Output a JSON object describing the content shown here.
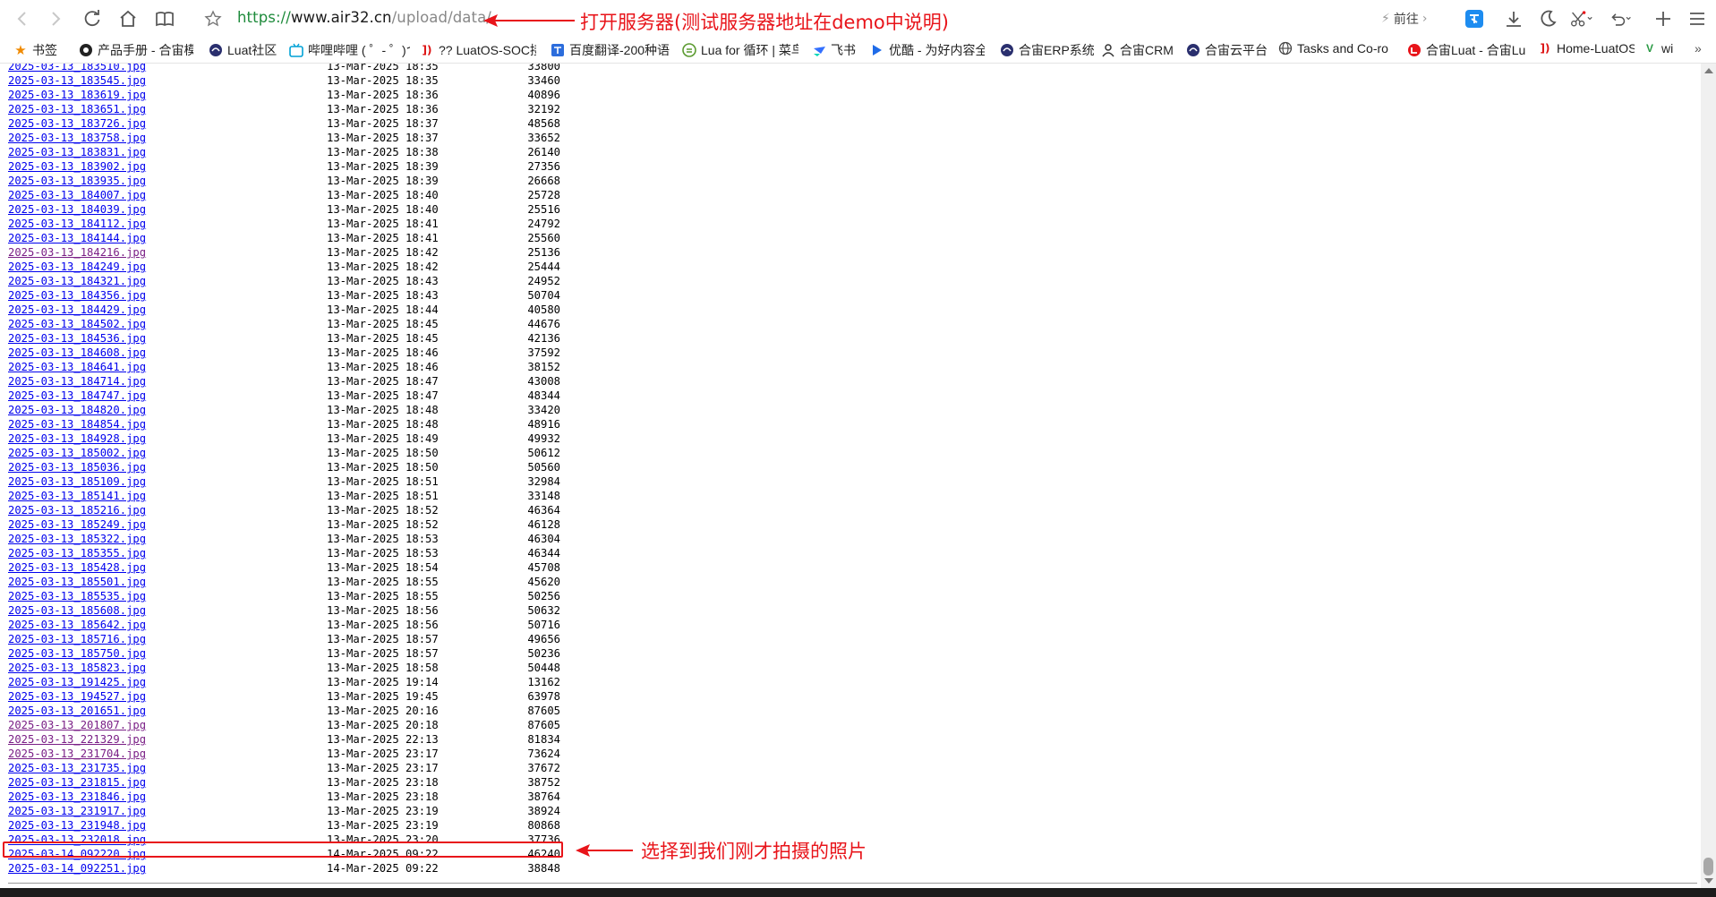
{
  "browser": {
    "url_scheme": "https://",
    "url_host": "www.air32.cn",
    "url_path": "/upload/data/",
    "goto_label": "前往"
  },
  "bookmarks": [
    {
      "label": "书签",
      "icon": "star-icon"
    },
    {
      "label": "产品手册 - 合宙模",
      "icon": "site-icon"
    },
    {
      "label": "Luat社区",
      "icon": "site-icon"
    },
    {
      "label": "哔哩哔哩 ( ゜- ゜)つ",
      "icon": "bilibili-icon"
    },
    {
      "label": "?? LuatOS-SOC接",
      "icon": "luatos-icon"
    },
    {
      "label": "百度翻译-200种语",
      "icon": "translate-icon"
    },
    {
      "label": "Lua for 循环 | 菜鸟",
      "icon": "runoob-icon"
    },
    {
      "label": "飞书",
      "icon": "feishu-icon"
    },
    {
      "label": "优酷 - 为好内容全",
      "icon": "youku-icon"
    },
    {
      "label": "合宙ERP系统",
      "icon": "site-icon"
    },
    {
      "label": "合宙CRM",
      "icon": "person-icon"
    },
    {
      "label": "合宙云平台",
      "icon": "site-icon"
    },
    {
      "label": "Tasks and Co-ro",
      "icon": "globe-icon"
    },
    {
      "label": "合宙Luat - 合宙Lu",
      "icon": "luat-icon"
    },
    {
      "label": "Home-LuatOS",
      "icon": "luatos-icon"
    },
    {
      "label": "wi",
      "icon": "v-icon"
    }
  ],
  "listing": {
    "partial_top_row": {
      "name": "2025-03-13_183510.jpg",
      "date": "13-Mar-2025 18:35",
      "size": "33800"
    },
    "rows": [
      {
        "name": "2025-03-13_183545.jpg",
        "date": "13-Mar-2025 18:35",
        "size": "33460"
      },
      {
        "name": "2025-03-13_183619.jpg",
        "date": "13-Mar-2025 18:36",
        "size": "40896"
      },
      {
        "name": "2025-03-13_183651.jpg",
        "date": "13-Mar-2025 18:36",
        "size": "32192"
      },
      {
        "name": "2025-03-13_183726.jpg",
        "date": "13-Mar-2025 18:37",
        "size": "48568"
      },
      {
        "name": "2025-03-13_183758.jpg",
        "date": "13-Mar-2025 18:37",
        "size": "33652"
      },
      {
        "name": "2025-03-13_183831.jpg",
        "date": "13-Mar-2025 18:38",
        "size": "26140"
      },
      {
        "name": "2025-03-13_183902.jpg",
        "date": "13-Mar-2025 18:39",
        "size": "27356"
      },
      {
        "name": "2025-03-13_183935.jpg",
        "date": "13-Mar-2025 18:39",
        "size": "26668"
      },
      {
        "name": "2025-03-13_184007.jpg",
        "date": "13-Mar-2025 18:40",
        "size": "25728"
      },
      {
        "name": "2025-03-13_184039.jpg",
        "date": "13-Mar-2025 18:40",
        "size": "25516"
      },
      {
        "name": "2025-03-13_184112.jpg",
        "date": "13-Mar-2025 18:41",
        "size": "24792"
      },
      {
        "name": "2025-03-13_184144.jpg",
        "date": "13-Mar-2025 18:41",
        "size": "25560"
      },
      {
        "name": "2025-03-13_184216.jpg",
        "date": "13-Mar-2025 18:42",
        "size": "25136",
        "visited": true
      },
      {
        "name": "2025-03-13_184249.jpg",
        "date": "13-Mar-2025 18:42",
        "size": "25444"
      },
      {
        "name": "2025-03-13_184321.jpg",
        "date": "13-Mar-2025 18:43",
        "size": "24952"
      },
      {
        "name": "2025-03-13_184356.jpg",
        "date": "13-Mar-2025 18:43",
        "size": "50704"
      },
      {
        "name": "2025-03-13_184429.jpg",
        "date": "13-Mar-2025 18:44",
        "size": "40580"
      },
      {
        "name": "2025-03-13_184502.jpg",
        "date": "13-Mar-2025 18:45",
        "size": "44676"
      },
      {
        "name": "2025-03-13_184536.jpg",
        "date": "13-Mar-2025 18:45",
        "size": "42136"
      },
      {
        "name": "2025-03-13_184608.jpg",
        "date": "13-Mar-2025 18:46",
        "size": "37592"
      },
      {
        "name": "2025-03-13_184641.jpg",
        "date": "13-Mar-2025 18:46",
        "size": "38152"
      },
      {
        "name": "2025-03-13_184714.jpg",
        "date": "13-Mar-2025 18:47",
        "size": "43008"
      },
      {
        "name": "2025-03-13_184747.jpg",
        "date": "13-Mar-2025 18:47",
        "size": "48344"
      },
      {
        "name": "2025-03-13_184820.jpg",
        "date": "13-Mar-2025 18:48",
        "size": "33420"
      },
      {
        "name": "2025-03-13_184854.jpg",
        "date": "13-Mar-2025 18:48",
        "size": "48916"
      },
      {
        "name": "2025-03-13_184928.jpg",
        "date": "13-Mar-2025 18:49",
        "size": "49932"
      },
      {
        "name": "2025-03-13_185002.jpg",
        "date": "13-Mar-2025 18:50",
        "size": "50612"
      },
      {
        "name": "2025-03-13_185036.jpg",
        "date": "13-Mar-2025 18:50",
        "size": "50560"
      },
      {
        "name": "2025-03-13_185109.jpg",
        "date": "13-Mar-2025 18:51",
        "size": "32984"
      },
      {
        "name": "2025-03-13_185141.jpg",
        "date": "13-Mar-2025 18:51",
        "size": "33148"
      },
      {
        "name": "2025-03-13_185216.jpg",
        "date": "13-Mar-2025 18:52",
        "size": "46364"
      },
      {
        "name": "2025-03-13_185249.jpg",
        "date": "13-Mar-2025 18:52",
        "size": "46128"
      },
      {
        "name": "2025-03-13_185322.jpg",
        "date": "13-Mar-2025 18:53",
        "size": "46304"
      },
      {
        "name": "2025-03-13_185355.jpg",
        "date": "13-Mar-2025 18:53",
        "size": "46344"
      },
      {
        "name": "2025-03-13_185428.jpg",
        "date": "13-Mar-2025 18:54",
        "size": "45708"
      },
      {
        "name": "2025-03-13_185501.jpg",
        "date": "13-Mar-2025 18:55",
        "size": "45620"
      },
      {
        "name": "2025-03-13_185535.jpg",
        "date": "13-Mar-2025 18:55",
        "size": "50256"
      },
      {
        "name": "2025-03-13_185608.jpg",
        "date": "13-Mar-2025 18:56",
        "size": "50632"
      },
      {
        "name": "2025-03-13_185642.jpg",
        "date": "13-Mar-2025 18:56",
        "size": "50716"
      },
      {
        "name": "2025-03-13_185716.jpg",
        "date": "13-Mar-2025 18:57",
        "size": "49656"
      },
      {
        "name": "2025-03-13_185750.jpg",
        "date": "13-Mar-2025 18:57",
        "size": "50236"
      },
      {
        "name": "2025-03-13_185823.jpg",
        "date": "13-Mar-2025 18:58",
        "size": "50448"
      },
      {
        "name": "2025-03-13_191425.jpg",
        "date": "13-Mar-2025 19:14",
        "size": "13162"
      },
      {
        "name": "2025-03-13_194527.jpg",
        "date": "13-Mar-2025 19:45",
        "size": "63978"
      },
      {
        "name": "2025-03-13_201651.jpg",
        "date": "13-Mar-2025 20:16",
        "size": "87605"
      },
      {
        "name": "2025-03-13_201807.jpg",
        "date": "13-Mar-2025 20:18",
        "size": "87605",
        "visited": true
      },
      {
        "name": "2025-03-13_221329.jpg",
        "date": "13-Mar-2025 22:13",
        "size": "81834",
        "visited": true
      },
      {
        "name": "2025-03-13_231704.jpg",
        "date": "13-Mar-2025 23:17",
        "size": "73624",
        "visited": true
      },
      {
        "name": "2025-03-13_231735.jpg",
        "date": "13-Mar-2025 23:17",
        "size": "37672"
      },
      {
        "name": "2025-03-13_231815.jpg",
        "date": "13-Mar-2025 23:18",
        "size": "38752"
      },
      {
        "name": "2025-03-13_231846.jpg",
        "date": "13-Mar-2025 23:18",
        "size": "38764"
      },
      {
        "name": "2025-03-13_231917.jpg",
        "date": "13-Mar-2025 23:19",
        "size": "38924"
      },
      {
        "name": "2025-03-13_231948.jpg",
        "date": "13-Mar-2025 23:19",
        "size": "80868"
      },
      {
        "name": "2025-03-13_232018.jpg",
        "date": "13-Mar-2025 23:20",
        "size": "37736"
      },
      {
        "name": "2025-03-14_092220.jpg",
        "date": "14-Mar-2025 09:22",
        "size": "46240",
        "highlighted": true
      },
      {
        "name": "2025-03-14_092251.jpg",
        "date": "14-Mar-2025 09:22",
        "size": "38848"
      }
    ]
  },
  "annotations": {
    "top": "打开服务器(测试服务器地址在demo中说明)",
    "bottom": "选择到我们刚才拍摄的照片",
    "color": "#e8141a"
  },
  "colors": {
    "link": "#0000ee",
    "visited": "#7a1f86",
    "url_scheme": "#1f8b3c"
  }
}
